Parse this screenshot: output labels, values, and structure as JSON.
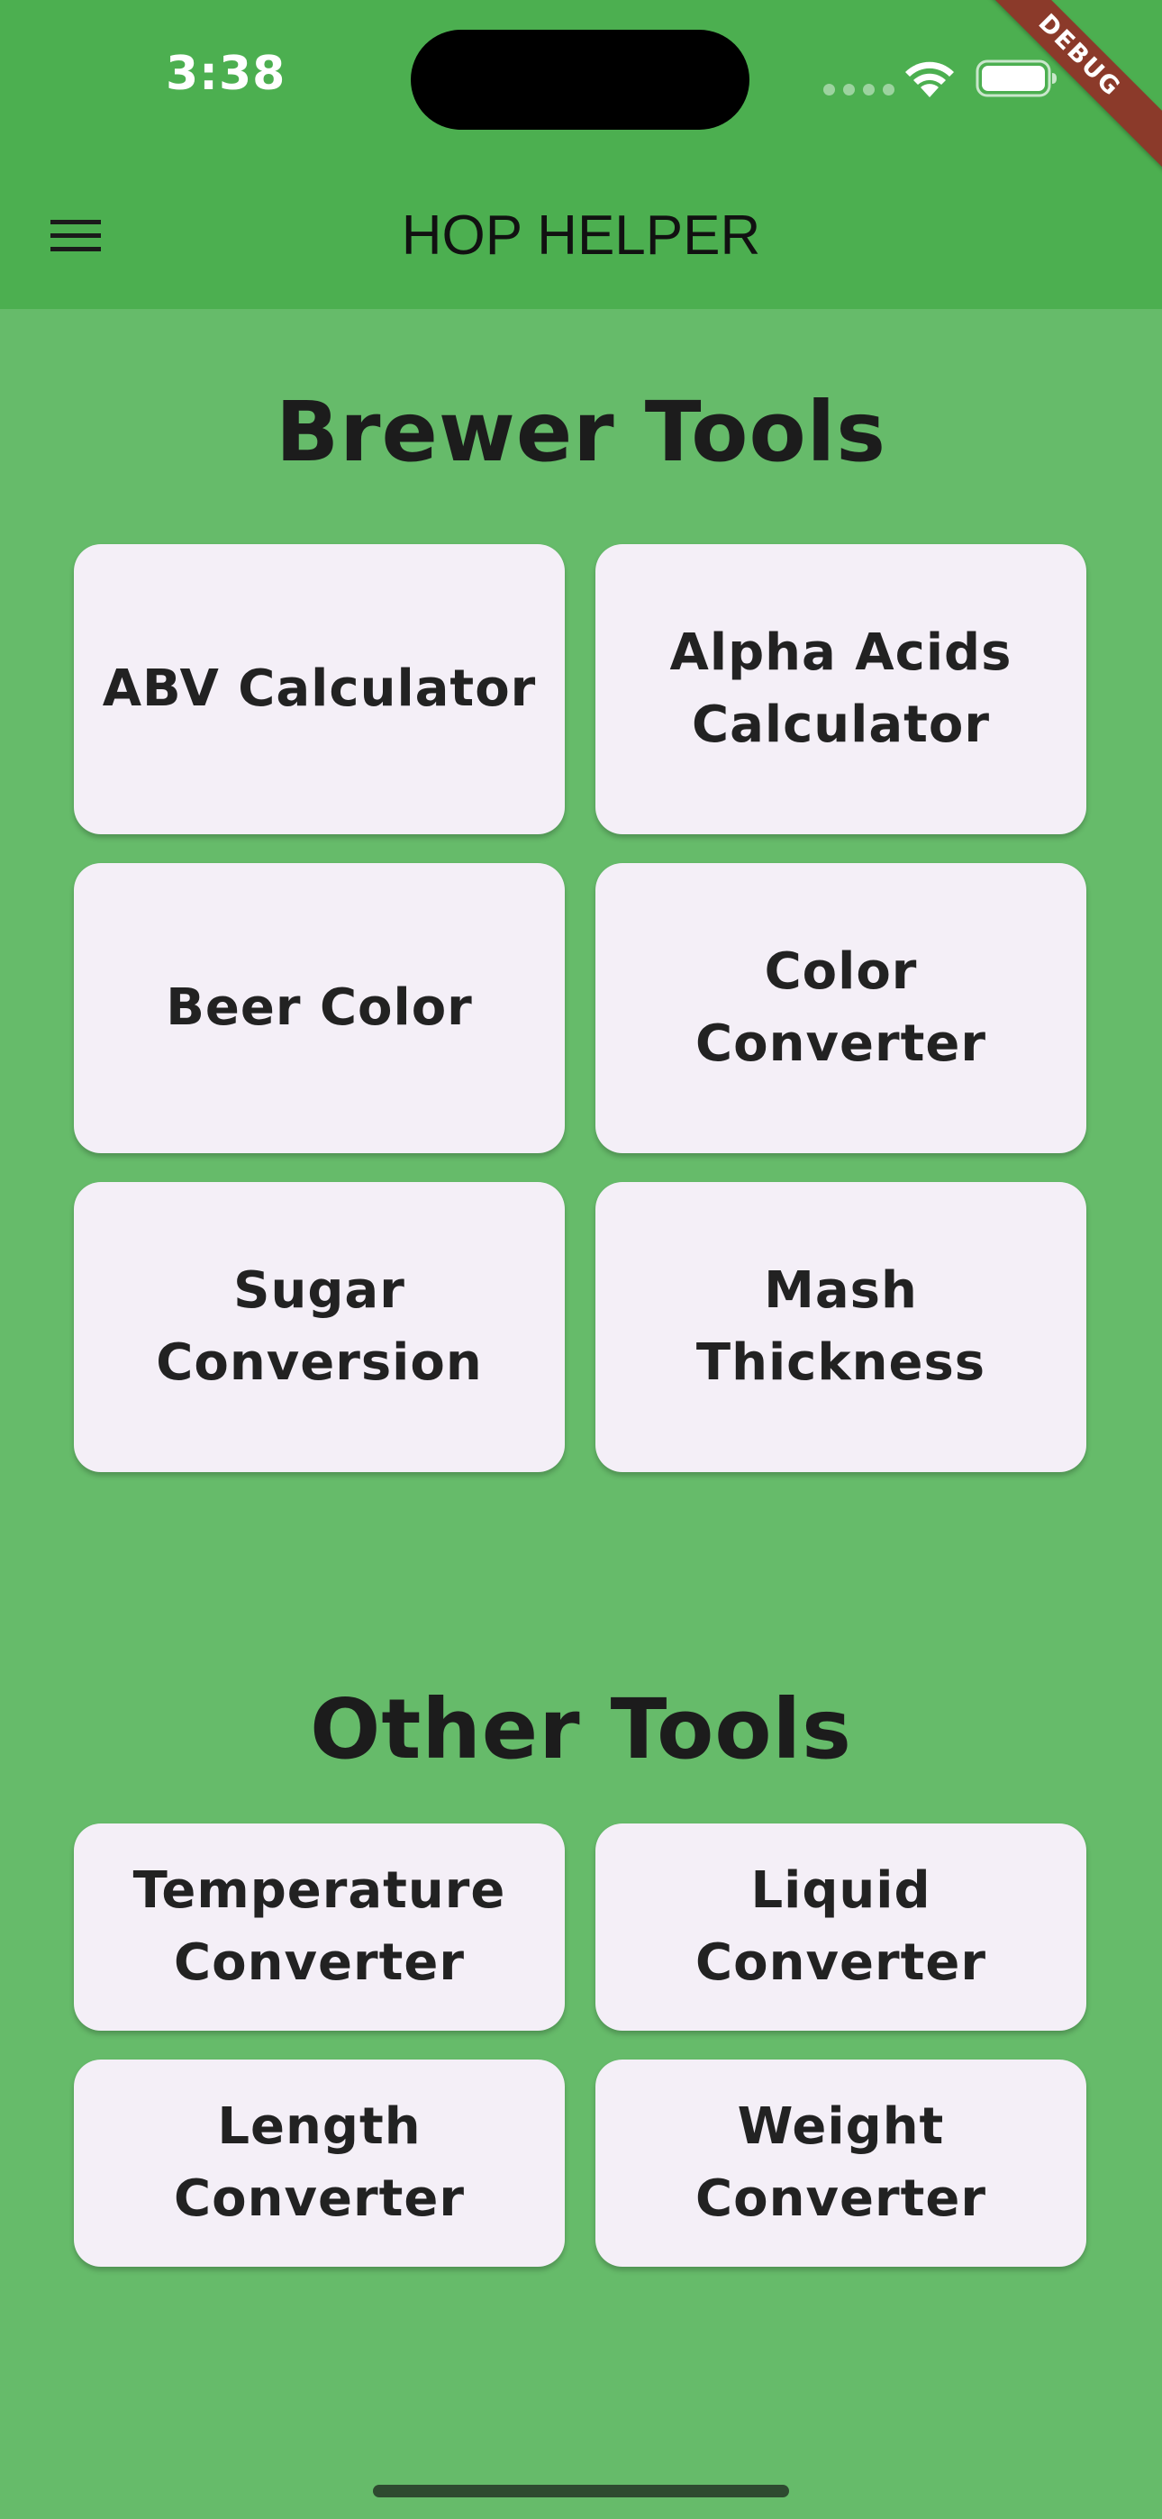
{
  "status_bar": {
    "time": "3:38"
  },
  "debug_banner": "DEBUG",
  "app_bar": {
    "title": "HOP HELPER",
    "menu_icon": "hamburger-menu-icon"
  },
  "brewer_tools": {
    "title": "Brewer Tools",
    "items": [
      {
        "label": "ABV Calculator"
      },
      {
        "label": "Alpha Acids Calculator"
      },
      {
        "label": "Beer Color"
      },
      {
        "label": "Color Converter"
      },
      {
        "label": "Sugar Conversion"
      },
      {
        "label": "Mash Thickness"
      }
    ]
  },
  "other_tools": {
    "title": "Other Tools",
    "items": [
      {
        "label": "Temperature Converter"
      },
      {
        "label": "Liquid Converter"
      },
      {
        "label": "Length Converter"
      },
      {
        "label": "Weight Converter"
      }
    ]
  },
  "colors": {
    "app_bar": "#4caf50",
    "background": "#66bb6a",
    "card": "#f4eff7",
    "debug_ribbon": "#8b3a2a"
  }
}
